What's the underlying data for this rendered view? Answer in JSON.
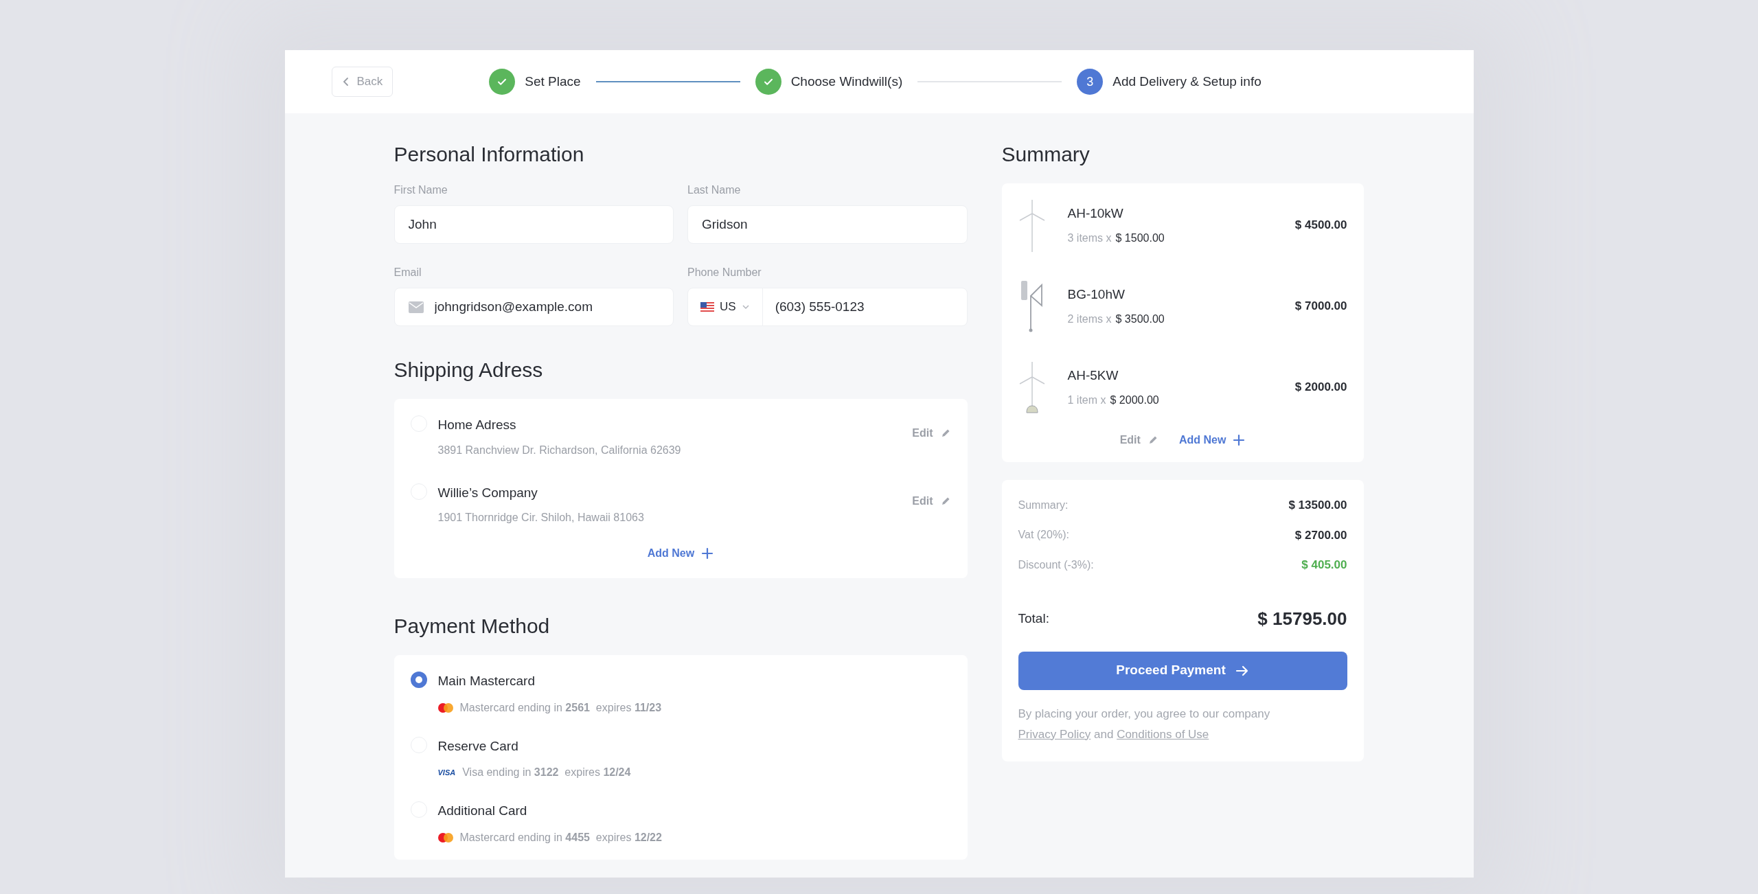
{
  "back_button": {
    "label": "Back"
  },
  "steps": [
    {
      "label": "Set Place",
      "completed": true
    },
    {
      "label": "Choose Windwill(s)",
      "completed": true
    },
    {
      "label": "Add Delivery & Setup info",
      "completed": false,
      "number": "3"
    }
  ],
  "personal": {
    "title": "Personal Information",
    "first_name": {
      "label": "First Name",
      "value": "John"
    },
    "last_name": {
      "label": "Last Name",
      "value": "Gridson"
    },
    "email": {
      "label": "Email",
      "value": "johngridson@example.com"
    },
    "phone": {
      "label": "Phone Number",
      "country": "US",
      "value": "(603) 555-0123"
    }
  },
  "shipping": {
    "title": "Shipping Adress",
    "add_label": "Add New",
    "addresses": [
      {
        "name": "Home Adress",
        "address": "3891 Ranchview Dr. Richardson, California 62639",
        "edit_label": "Edit",
        "selected": false
      },
      {
        "name": "Willie’s Company",
        "address": "1901 Thornridge Cir. Shiloh, Hawaii 81063",
        "edit_label": "Edit",
        "selected": false
      }
    ]
  },
  "payment": {
    "title": "Payment Method",
    "cards": [
      {
        "name": "Main Mastercard",
        "kind": "mastercard",
        "detail": "Mastercard ending in **2561**  expires **11/23**",
        "selected": true
      },
      {
        "name": "Reserve Card",
        "kind": "visa",
        "brand_label": "VISA",
        "detail": "Visa ending in **3122**  expires **12/24**",
        "selected": false
      },
      {
        "name": "Additional Card",
        "kind": "mastercard",
        "detail": "Mastercard ending in **4455**  expires **12/22**",
        "selected": false
      }
    ]
  },
  "summary": {
    "title": "Summary",
    "edit_label": "Edit",
    "add_label": "Add New",
    "items": [
      {
        "name": "AH-10kW",
        "kind": "horizontal",
        "quantity": "3 items x",
        "unit_price": "$ 1500.00",
        "total": "$ 4500.00"
      },
      {
        "name": "BG-10hW",
        "kind": "vertical",
        "quantity": "2 items x",
        "unit_price": "$ 3500.00",
        "total": "$ 7000.00"
      },
      {
        "name": "AH-5KW",
        "kind": "horizontal-base",
        "quantity": "1 item x",
        "unit_price": "$ 2000.00",
        "total": "$ 2000.00"
      }
    ],
    "totals": [
      {
        "label": "Summary:",
        "value": "$ 13500.00",
        "kind": "plain"
      },
      {
        "label": "Vat (20%):",
        "value": "$ 2700.00",
        "kind": "plain"
      },
      {
        "label": "Discount (-3%):",
        "value": "$ 405.00",
        "kind": "discount"
      }
    ],
    "total": {
      "label": "Total:",
      "value": "$ 15795.00"
    },
    "proceed_button": {
      "label": "Proceed Payment"
    },
    "agreement": {
      "text": "By placing your order, you agree to our company",
      "link_1": "Privacy Policy",
      "joiner": "and",
      "link_2": "Conditions of Use"
    }
  }
}
